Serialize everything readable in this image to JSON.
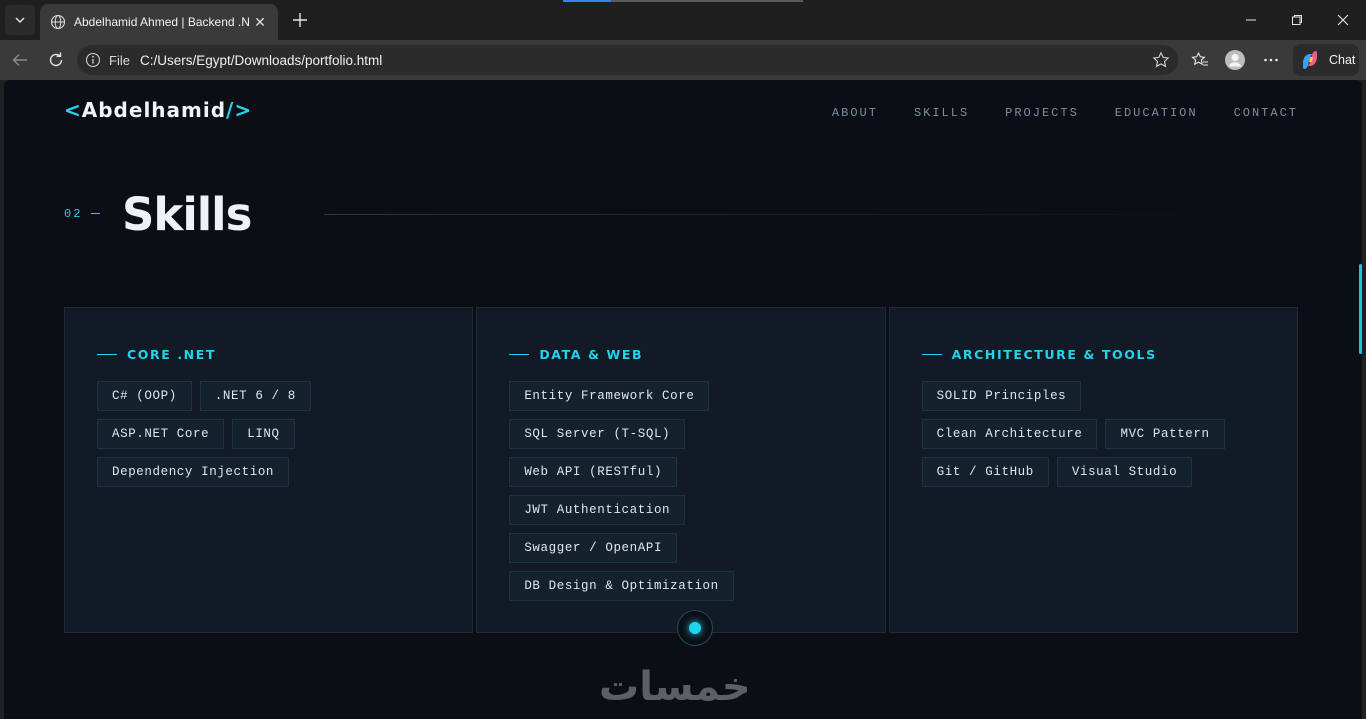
{
  "browser": {
    "tab_title": "Abdelhamid Ahmed | Backend .NE",
    "address_scheme_label": "File",
    "url": "C:/Users/Egypt/Downloads/portfolio.html",
    "chat_label": "Chat"
  },
  "site": {
    "logo_open": "<",
    "logo_name": "Abdelhamid",
    "logo_close": "/>",
    "nav": [
      "ABOUT",
      "SKILLS",
      "PROJECTS",
      "EDUCATION",
      "CONTACT"
    ]
  },
  "section": {
    "number": "02",
    "title": "Skills"
  },
  "cards": [
    {
      "title": "CORE .NET",
      "chips": [
        "C# (OOP)",
        ".NET 6 / 8",
        "ASP.NET Core",
        "LINQ",
        "Dependency Injection"
      ]
    },
    {
      "title": "DATA & WEB",
      "chips": [
        "Entity Framework Core",
        "SQL Server (T-SQL)",
        "Web API (RESTful)",
        "JWT Authentication",
        "Swagger / OpenAPI",
        "DB Design & Optimization"
      ]
    },
    {
      "title": "ARCHITECTURE & TOOLS",
      "chips": [
        "SOLID Principles",
        "Clean Architecture",
        "MVC Pattern",
        "Git / GitHub",
        "Visual Studio"
      ]
    }
  ],
  "watermark": "خمسات",
  "colors": {
    "accent": "#22d3ee",
    "page_bg": "#0b0f15",
    "card_bg": "#121a25"
  }
}
